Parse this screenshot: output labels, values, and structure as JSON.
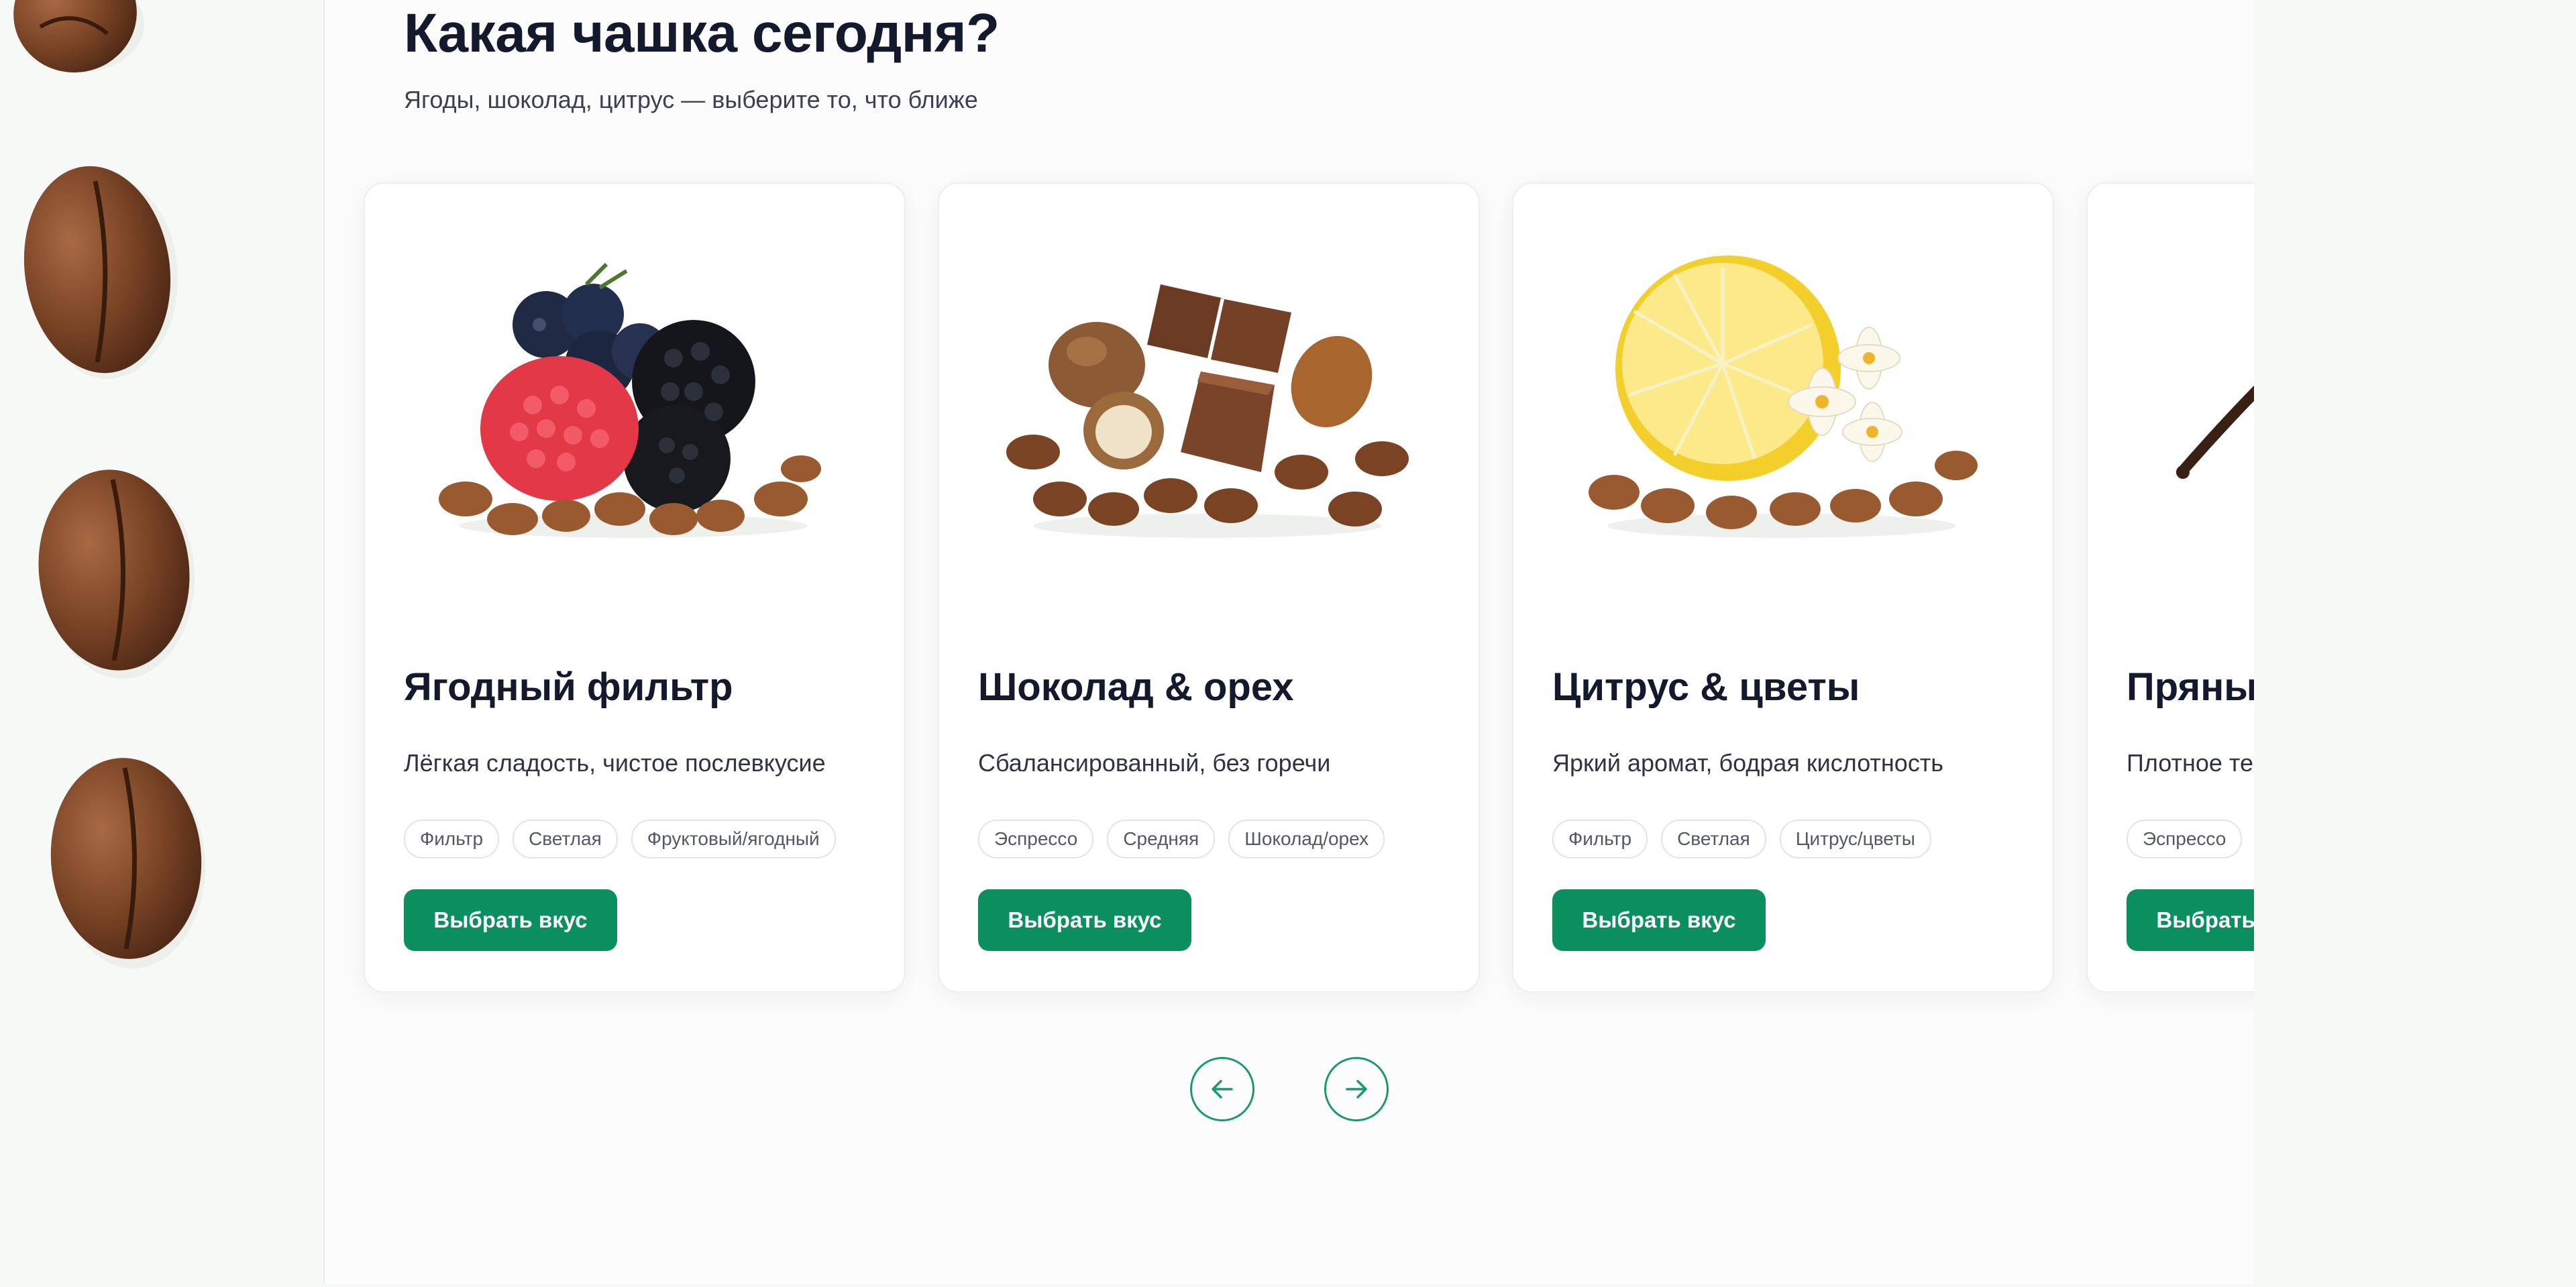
{
  "section": {
    "title": "Какая чашка сегодня?",
    "subtitle": "Ягоды, шоколад, цитрус — выберите то, что ближе"
  },
  "cards": [
    {
      "title": "Ягодный фильтр",
      "description": "Лёгкая сладость, чистое послевкусие",
      "tags": [
        "Фильтр",
        "Светлая",
        "Фруктовый/ягодный"
      ],
      "button_label": "Выбрать вкус",
      "image_icon": "berries-coffee-illustration"
    },
    {
      "title": "Шоколад & орех",
      "description": "Сбалансированный, без горечи",
      "tags": [
        "Эспрессо",
        "Средняя",
        "Шоколад/орех"
      ],
      "button_label": "Выбрать вкус",
      "image_icon": "chocolate-nuts-illustration"
    },
    {
      "title": "Цитрус & цветы",
      "description": "Яркий аромат, бодрая кислотность",
      "tags": [
        "Фильтр",
        "Светлая",
        "Цитрус/цветы"
      ],
      "button_label": "Выбрать вкус",
      "image_icon": "lemon-flowers-illustration"
    },
    {
      "title": "Пряны",
      "description": "Плотное те",
      "tags": [
        "Эспрессо"
      ],
      "button_label": "Выбрать вкус",
      "image_icon": "vanilla-spice-illustration"
    }
  ],
  "carousel": {
    "prev_icon": "arrow-left-icon",
    "next_icon": "arrow-right-icon"
  },
  "colors": {
    "accent": "#0c8f5f",
    "heading": "#141a2e",
    "page_background": "#f7f9f7"
  }
}
